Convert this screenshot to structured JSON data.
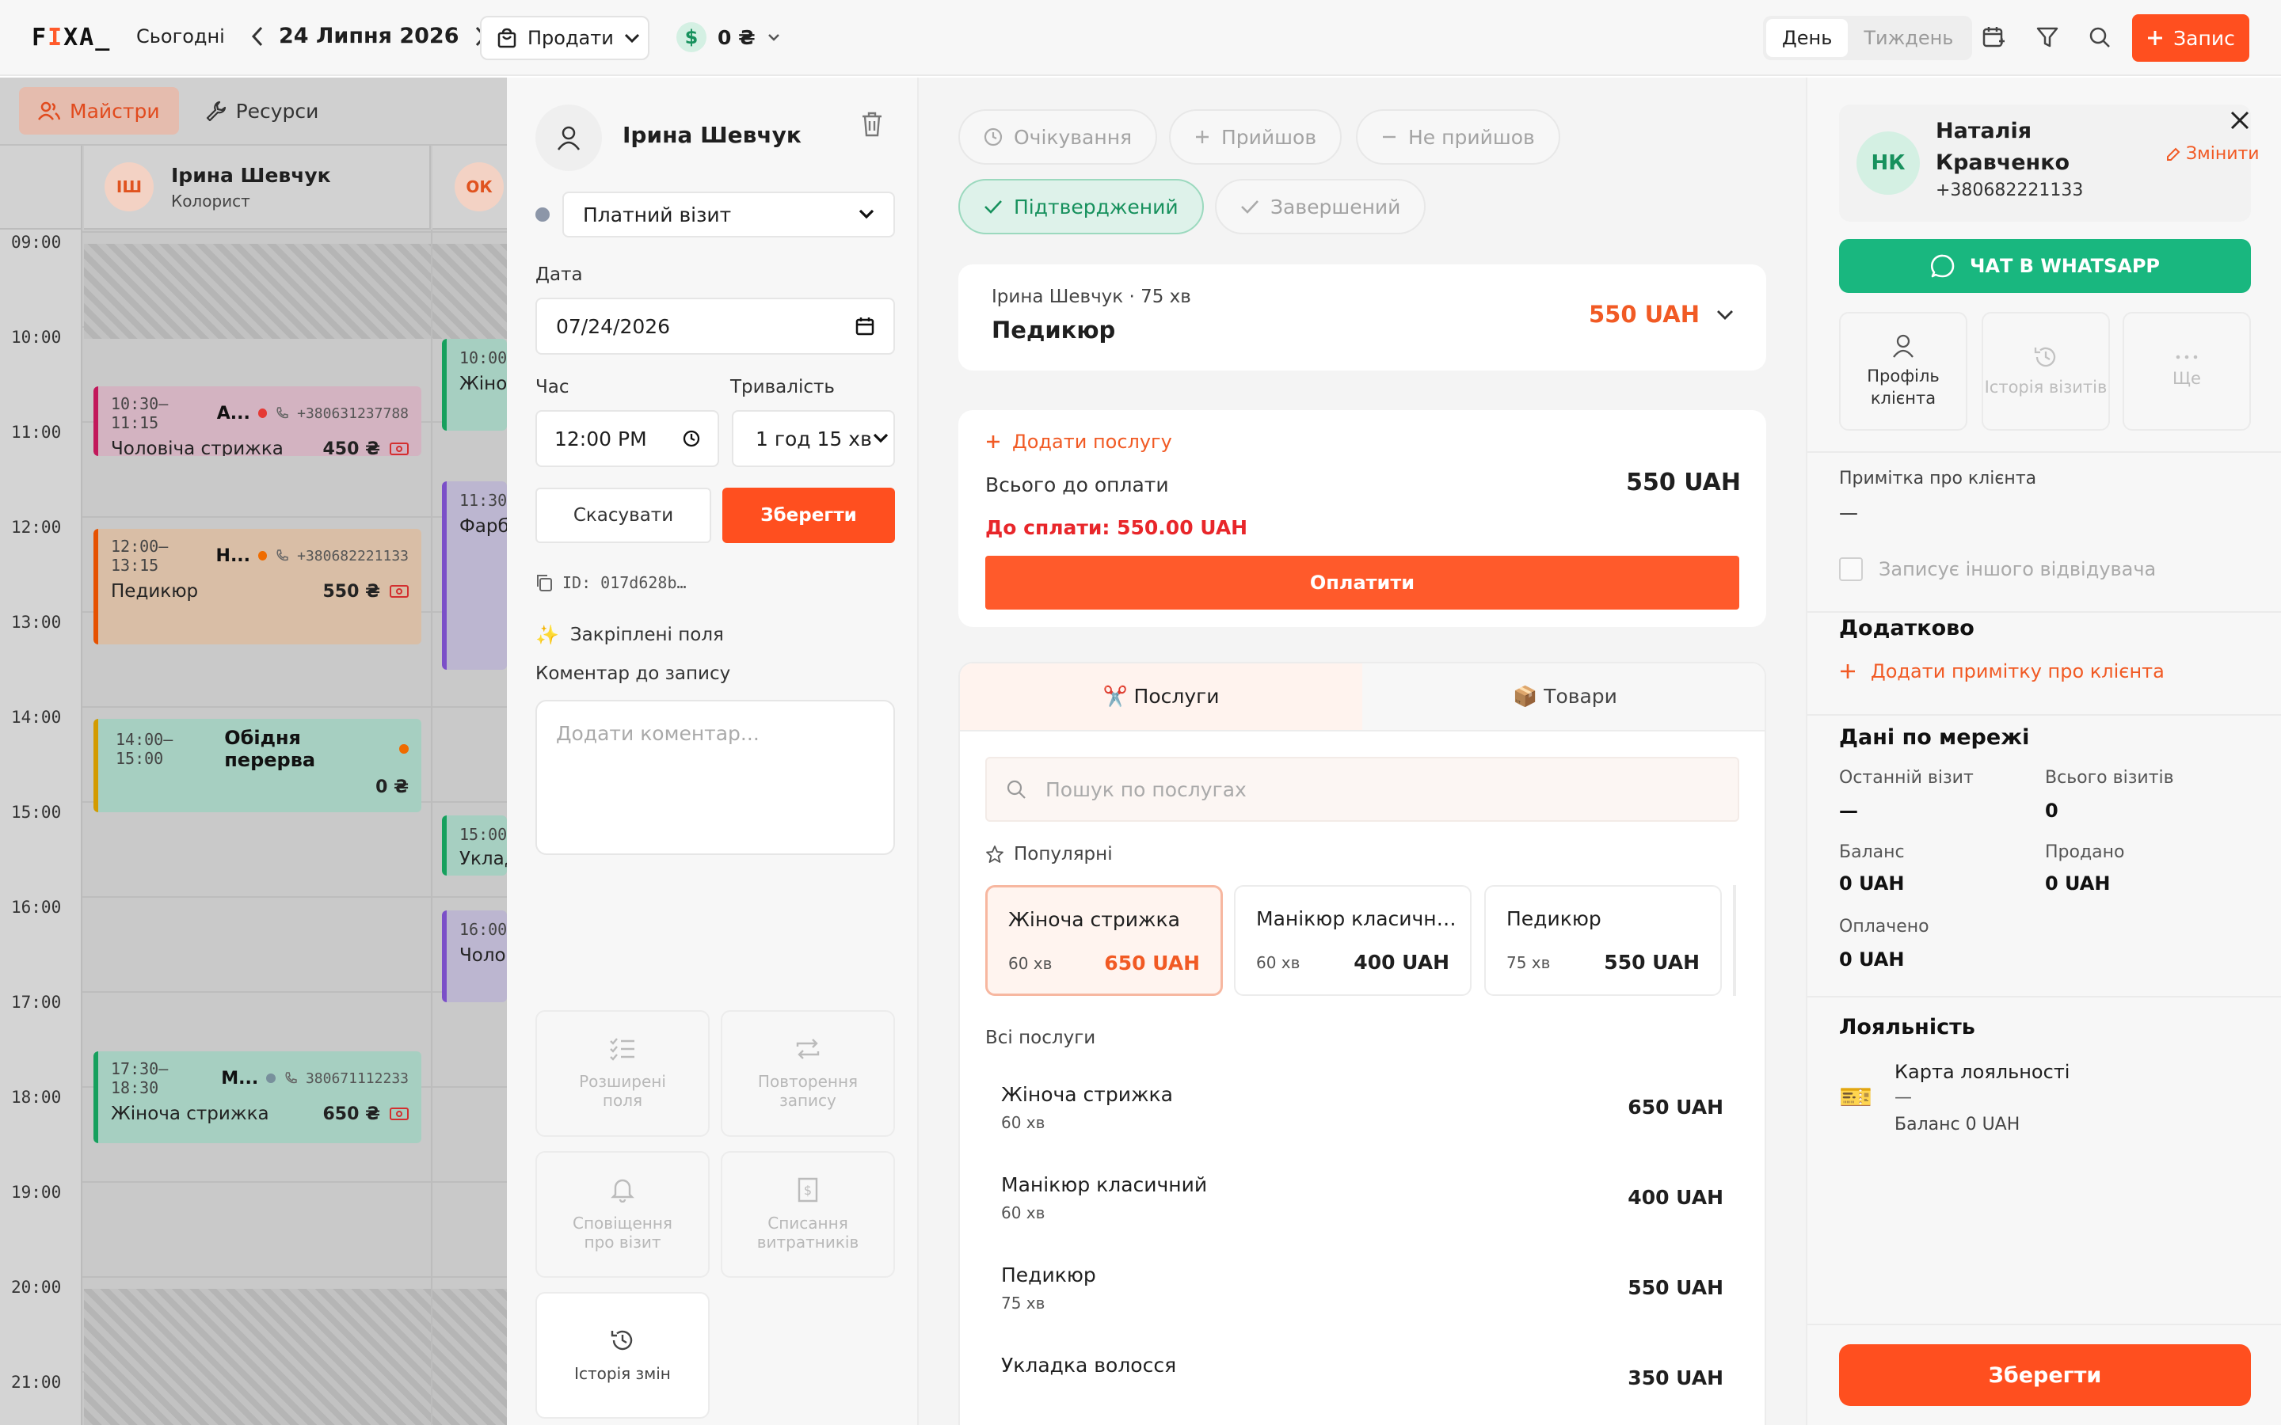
{
  "app": {
    "logo_pre": "F",
    "logo_i": "I",
    "logo_post": "XA_"
  },
  "topbar": {
    "today": "Сьогодні",
    "date": "24 Липня 2026",
    "sell": "Продати",
    "balance": "0 ₴",
    "view_day": "День",
    "view_week": "Тиждень",
    "new_booking": "Запис"
  },
  "calendar": {
    "tabs": {
      "masters": "Майстри",
      "resources": "Ресурси"
    },
    "resources": [
      {
        "initials": "ІШ",
        "name": "Ірина Шевчук",
        "role": "Колорист"
      },
      {
        "initials": "ОК"
      }
    ],
    "hours": [
      "09:00",
      "10:00",
      "11:00",
      "12:00",
      "13:00",
      "14:00",
      "15:00",
      "16:00",
      "17:00",
      "18:00",
      "19:00",
      "20:00",
      "21:00"
    ],
    "events": [
      {
        "time": "10:30–11:15",
        "client": "А...",
        "phone": "+380631237788",
        "service": "Чоловіча стрижка",
        "price": "450 ₴",
        "bg": "#d3b3c1",
        "bar": "#c2185b"
      },
      {
        "time": "12:00–13:15",
        "client": "Н...",
        "phone": "+380682221133",
        "service": "Педикюр",
        "price": "550 ₴",
        "bg": "#d9bea6",
        "bar": "#e65100"
      },
      {
        "time": "14:00–15:00",
        "client": "Обідня перерва",
        "price": "0 ₴",
        "bg": "#a6cfc1",
        "bar": "#d39b00"
      },
      {
        "time": "17:30–18:30",
        "client": "М...",
        "phone": "380671112233",
        "service": "Жіноча стрижка",
        "price": "650 ₴",
        "bg": "#a6cfc1",
        "bar": "#16a05d"
      }
    ],
    "events_col2": [
      {
        "time": "10:00",
        "service": "Жіно",
        "bg": "#a6cfc1",
        "bar": "#16a05d"
      },
      {
        "time": "11:30",
        "service": "Фарб",
        "bg": "#bcb6d0",
        "bar": "#7b4fc8"
      },
      {
        "time": "15:00",
        "service": "Уклад",
        "bg": "#a6cfc1",
        "bar": "#16a05d"
      },
      {
        "time": "16:00",
        "service": "Чолов",
        "bg": "#bcb6d0",
        "bar": "#7b4fc8"
      }
    ]
  },
  "form": {
    "master_name": "Ірина Шевчук",
    "visit_type": "Платний візит",
    "date_label": "Дата",
    "date_value": "07/24/2026",
    "time_label": "Час",
    "time_value": "12:00 PM",
    "duration_label": "Тривалість",
    "duration_value": "1 год 15 хв",
    "cancel": "Скасувати",
    "save": "Зберегти",
    "id": "ID: 017d628b…",
    "pinned": "Закріплені поля",
    "comment_label": "Коментар до запису",
    "comment_placeholder": "Додати коментар...",
    "tiles": [
      {
        "label1": "Розширені",
        "label2": "поля"
      },
      {
        "label1": "Повторення",
        "label2": "запису"
      },
      {
        "label1": "Сповіщення",
        "label2": "про візит"
      },
      {
        "label1": "Списання",
        "label2": "витратників"
      },
      {
        "label1": "Історія змін",
        "label2": ""
      }
    ]
  },
  "status": {
    "waiting": "Очікування",
    "arrived": "Прийшов",
    "no_show": "Не прийшов",
    "confirmed": "Підтверджений",
    "completed": "Завершений"
  },
  "service_line": {
    "meta": "Ірина Шевчук · 75 хв",
    "name": "Педикюр",
    "price": "550 UAH"
  },
  "payment": {
    "add_service": "Додати послугу",
    "total_label": "Всього до оплати",
    "total_value": "550 UAH",
    "due": "До сплати: 550.00 UAH",
    "pay": "Оплатити"
  },
  "catalog": {
    "tab_services": "✂️ Послуги",
    "tab_goods": "📦 Товари",
    "search_placeholder": "Пошук по послугах",
    "popular_label": "Популярні",
    "popular": [
      {
        "name": "Жіноча стрижка",
        "dur": "60 хв",
        "price": "650 UAH"
      },
      {
        "name": "Манікюр класичн…",
        "dur": "60 хв",
        "price": "400 UAH"
      },
      {
        "name": "Педикюр",
        "dur": "75 хв",
        "price": "550 UAH"
      }
    ],
    "all_label": "Всі послуги",
    "all": [
      {
        "name": "Жіноча стрижка",
        "dur": "60 хв",
        "price": "650 UAH"
      },
      {
        "name": "Манікюр класичний",
        "dur": "60 хв",
        "price": "400 UAH"
      },
      {
        "name": "Педикюр",
        "dur": "75 хв",
        "price": "550 UAH"
      },
      {
        "name": "Укладка волосся",
        "dur": "",
        "price": "350 UAH"
      }
    ]
  },
  "client": {
    "initials": "НК",
    "first_name": "Наталія",
    "last_name": "Кравченко",
    "phone": "+380682221133",
    "edit": "Змінити",
    "whatsapp": "ЧАТ В WHATSAPP",
    "actions": [
      {
        "label1": "Профіль",
        "label2": "клієнта"
      },
      {
        "label1": "Історія візитів",
        "label2": ""
      },
      {
        "label1": "Ще",
        "label2": ""
      }
    ],
    "note_label": "Примітка про клієнта",
    "note_value": "—",
    "other_visitor": "Записує іншого відвідувача",
    "extra_title": "Додатково",
    "add_note": "Додати примітку про клієнта",
    "network_title": "Дані по мережі",
    "stats": {
      "last_visit_k": "Останній візит",
      "last_visit_v": "—",
      "total_visits_k": "Всього візитів",
      "total_visits_v": "0",
      "balance_k": "Баланс",
      "balance_v": "0 UAH",
      "sold_k": "Продано",
      "sold_v": "0 UAH",
      "paid_k": "Оплачено",
      "paid_v": "0 UAH"
    },
    "loyalty_title": "Лояльність",
    "loyalty_card": "Карта лояльності",
    "loyalty_dash": "—",
    "loyalty_balance": "Баланс 0 UAH",
    "save": "Зберегти"
  },
  "colors": {
    "accent": "#ff4f1f",
    "green": "#19b77f",
    "price": "#f15a24"
  }
}
